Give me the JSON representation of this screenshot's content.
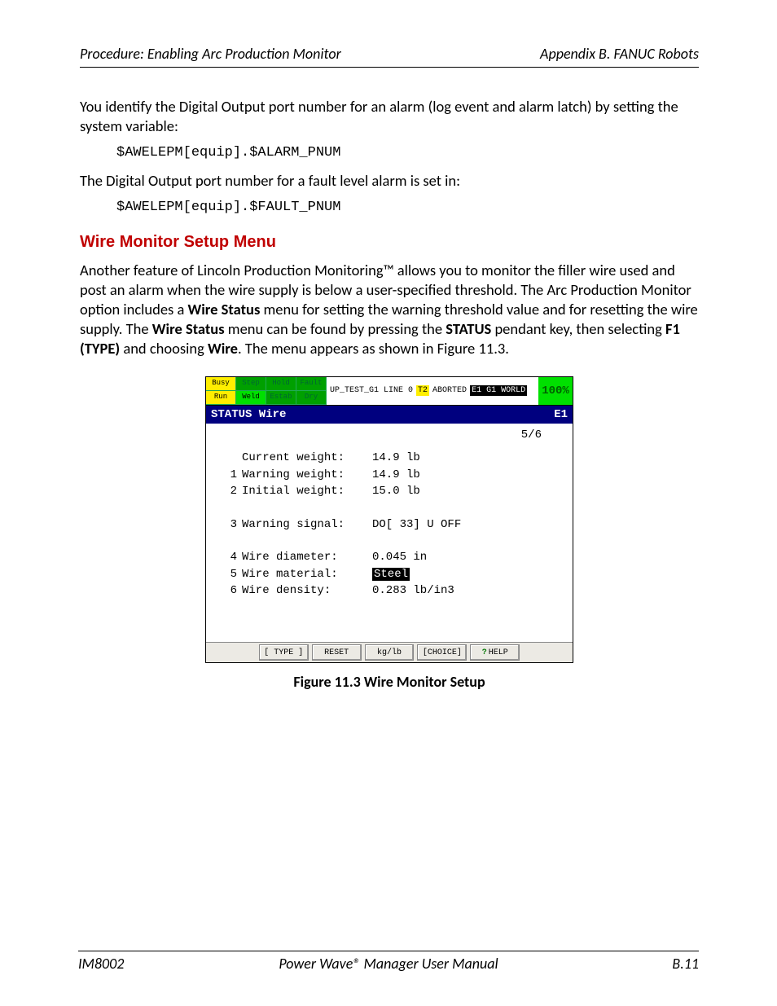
{
  "header": {
    "left": "Procedure: Enabling Arc Production Monitor",
    "right": "Appendix B. FANUC Robots"
  },
  "intro": {
    "p1": "You identify the Digital Output port number for an alarm (log event and alarm latch) by setting the system variable:",
    "code1": "$AWELEPM[equip].$ALARM_PNUM",
    "p2": "The Digital Output port number for a fault level alarm is set in:",
    "code2": "$AWELEPM[equip].$FAULT_PNUM"
  },
  "section_heading": "Wire Monitor Setup Menu",
  "section_body_parts": {
    "a": "Another feature of Lincoln Production Monitoring™ allows you to monitor the filler wire used and post an alarm when the wire supply is below a user-specified threshold.  The Arc Production Monitor option includes a ",
    "b": "Wire Status",
    "c": " menu for setting the warning threshold value and for resetting the wire supply.  The ",
    "d": "Wire Status",
    "e": " menu can be found by pressing the ",
    "f": "STATUS",
    "g": " pendant key, then selecting ",
    "h": "F1 (TYPE)",
    "i": " and choosing ",
    "j": "Wire",
    "k": ".  The menu appears as shown in Figure 11.3."
  },
  "figure_caption": "Figure 11.3   Wire Monitor Setup",
  "pendant": {
    "leds": {
      "r0c0": "Busy",
      "r0c1": "Step",
      "r0c2": "Hold",
      "r0c3": "Fault",
      "r1c0": "Run",
      "r1c1": "Weld",
      "r1c2": "Estab",
      "r1c3": "Dry"
    },
    "status_line": {
      "prog": "UP_TEST_G1 LINE 0",
      "t2": "T2",
      "state": "ABORTED",
      "coord": "E1 G1 WORLD"
    },
    "percent": "100%",
    "title_left": "STATUS Wire",
    "title_right": "E1",
    "counter": "5/6",
    "rows": [
      {
        "idx": "",
        "label": "Current weight:",
        "val": "14.9 lb"
      },
      {
        "idx": "1",
        "label": "Warning weight:",
        "val": "14.9 lb"
      },
      {
        "idx": "2",
        "label": "Initial weight:",
        "val": "15.0 lb"
      },
      {
        "idx": "",
        "label": "",
        "val": ""
      },
      {
        "idx": "3",
        "label": "Warning signal:",
        "val": "DO[  33] U OFF"
      },
      {
        "idx": "",
        "label": "",
        "val": ""
      },
      {
        "idx": "4",
        "label": "Wire diameter:",
        "val": "0.045 in"
      },
      {
        "idx": "5",
        "label": "Wire material:",
        "val": "Steel",
        "selected": true
      },
      {
        "idx": "6",
        "label": "Wire density:",
        "val": "0.283 lb/in3"
      }
    ],
    "softkeys": [
      "[ TYPE ]",
      "RESET",
      "kg/lb",
      "[CHOICE]",
      "HELP"
    ]
  },
  "footer": {
    "left": "IM8002",
    "center": "Power Wave® Manager User Manual",
    "right": "B.11"
  }
}
